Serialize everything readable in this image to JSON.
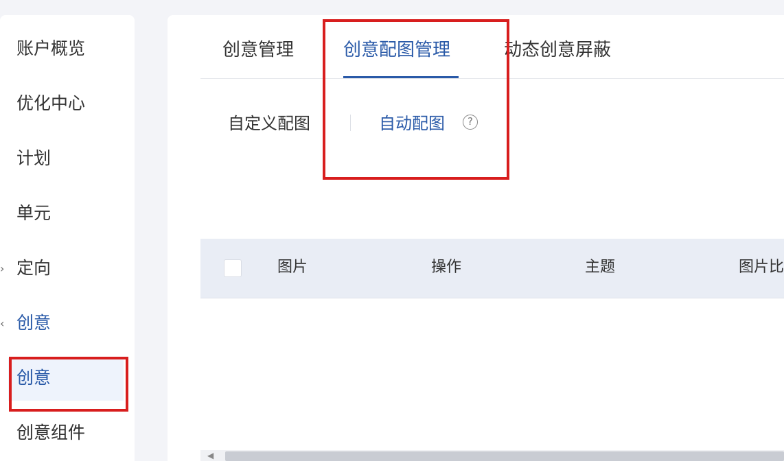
{
  "sidebar": {
    "items": [
      {
        "label": "账户概览"
      },
      {
        "label": "优化中心"
      },
      {
        "label": "计划"
      },
      {
        "label": "单元"
      },
      {
        "label": "定向",
        "arrow": "›"
      },
      {
        "label": "创意",
        "arrow": "‹"
      },
      {
        "label": "创意"
      },
      {
        "label": "创意组件"
      }
    ]
  },
  "tabs": [
    {
      "label": "创意管理"
    },
    {
      "label": "创意配图管理"
    },
    {
      "label": "动态创意屏蔽"
    }
  ],
  "subtabs": [
    {
      "label": "自定义配图"
    },
    {
      "label": "自动配图"
    }
  ],
  "help_icon": {
    "glyph": "?"
  },
  "table": {
    "columns": [
      {
        "label": "图片"
      },
      {
        "label": "操作"
      },
      {
        "label": "主题"
      },
      {
        "label": "图片比"
      }
    ]
  },
  "scrollbar": {
    "left_arrow": "◀"
  },
  "colors": {
    "accent": "#2a5aa8",
    "highlight_box": "#d81e1e"
  }
}
